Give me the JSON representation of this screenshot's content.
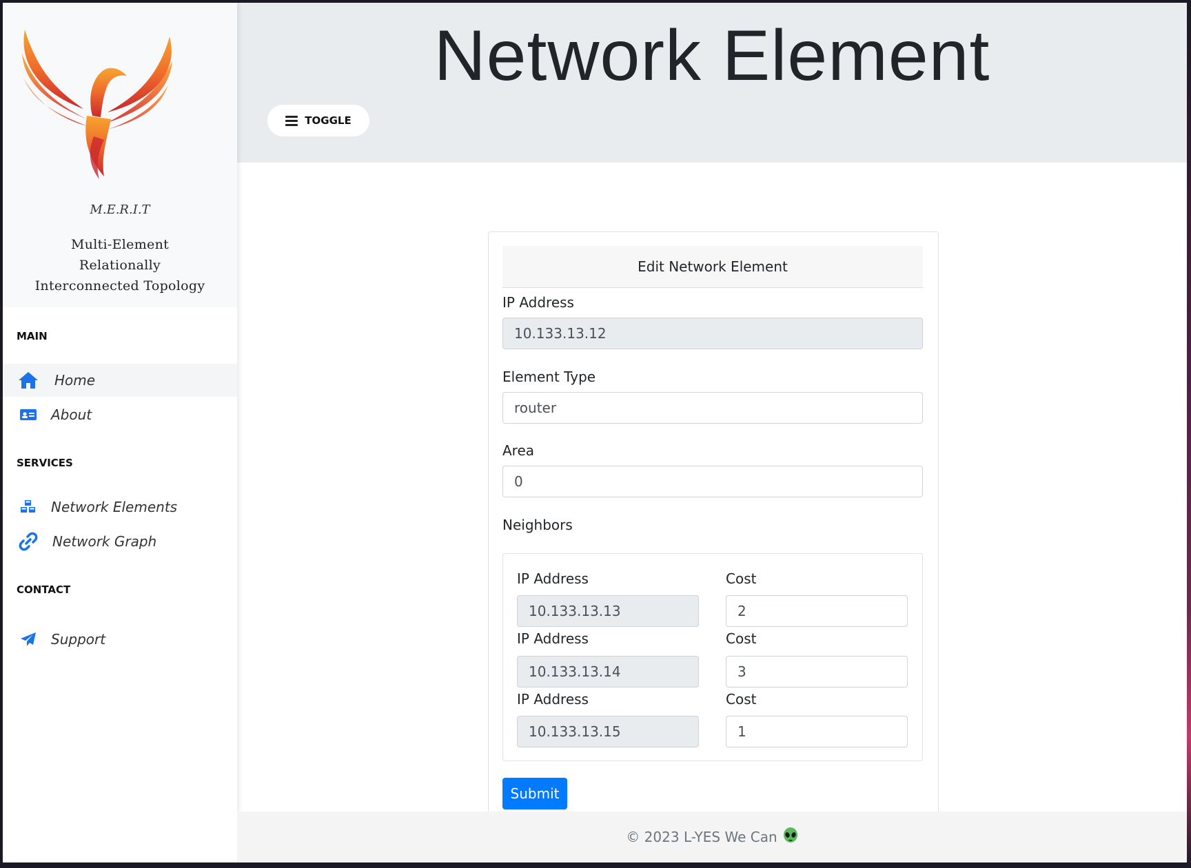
{
  "header": {
    "title": "Network Element",
    "toggle_label": "TOGGLE"
  },
  "brand": {
    "name": "M.E.R.I.T",
    "subtitle_line1": "Multi-Element Relationally",
    "subtitle_line2": "Interconnected Topology"
  },
  "sidebar": {
    "sections": {
      "main": "MAIN",
      "services": "SERVICES",
      "contact": "CONTACT"
    },
    "items": [
      {
        "label": "Home",
        "icon": "home-icon",
        "active": true
      },
      {
        "label": "About",
        "icon": "id-card-icon"
      },
      {
        "label": "Network Elements",
        "icon": "cubes-icon"
      },
      {
        "label": "Network Graph",
        "icon": "link-icon"
      },
      {
        "label": "Support",
        "icon": "paper-plane-icon"
      }
    ]
  },
  "form": {
    "header": "Edit Network Element",
    "ip_label": "IP Address",
    "ip_value": "10.133.13.12",
    "type_label": "Element Type",
    "type_value": "router",
    "area_label": "Area",
    "area_value": "0",
    "neighbors_label": "Neighbors",
    "neighbor_ip_label": "IP Address",
    "neighbor_cost_label": "Cost",
    "neighbors": [
      {
        "ip": "10.133.13.13",
        "cost": "2"
      },
      {
        "ip": "10.133.13.14",
        "cost": "3"
      },
      {
        "ip": "10.133.13.15",
        "cost": "1"
      }
    ],
    "submit_label": "Submit"
  },
  "footer": {
    "text": "© 2023 L-YES We Can"
  },
  "colors": {
    "accent": "#007bff",
    "header_bg": "#e9ecef",
    "sidebar_brand_bg": "#f8f9fa",
    "nav_icon": "#1a73e8"
  }
}
